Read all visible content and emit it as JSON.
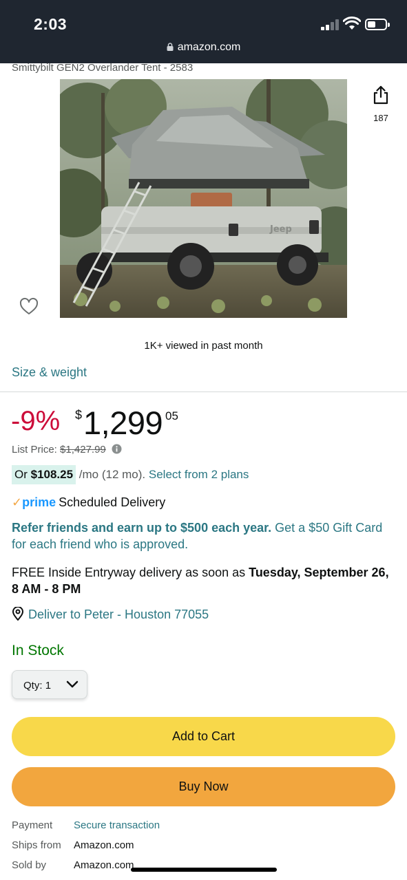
{
  "status_bar": {
    "time": "2:03"
  },
  "browser": {
    "url": "amazon.com"
  },
  "product": {
    "title": "Smittybilt GEN2 Overlander Tent - 2583",
    "share_count": "187",
    "viewed": "1K+ viewed in past month",
    "size_weight_link": "Size & weight"
  },
  "price": {
    "discount": "-9%",
    "currency_symbol": "$",
    "whole": "1,299",
    "fraction": "05",
    "list_price_label": "List Price:",
    "list_price_value": "$1,427.99"
  },
  "monthly": {
    "prefix": "Or ",
    "amount": "$108.25",
    "rest": " /mo (12 mo). ",
    "plans_link": "Select from 2 plans"
  },
  "prime": {
    "check": "✓",
    "logo": "prime",
    "text": "Scheduled Delivery"
  },
  "referral": {
    "bold": "Refer friends and earn up to $500 each year.",
    "rest": " Get a $50 Gift Card for each friend who is approved."
  },
  "delivery": {
    "text": "FREE Inside Entryway delivery as soon as ",
    "date": "Tuesday, September 26, 8 AM - 8 PM"
  },
  "deliver_to": "Deliver to Peter - Houston 77055",
  "stock_status": "In Stock",
  "quantity": {
    "label": "Qty:",
    "value": "1"
  },
  "buttons": {
    "add_to_cart": "Add to Cart",
    "buy_now": "Buy Now"
  },
  "details": [
    {
      "label": "Payment",
      "value": "Secure transaction"
    },
    {
      "label": "Ships from",
      "value": "Amazon.com"
    },
    {
      "label": "Sold by",
      "value": "Amazon.com"
    }
  ],
  "colors": {
    "link": "#2b7783",
    "discount": "#cc0c39",
    "in_stock": "#007600",
    "add_to_cart": "#f8d84a",
    "buy_now": "#f2a63e",
    "status_bar": "#1f2630"
  }
}
